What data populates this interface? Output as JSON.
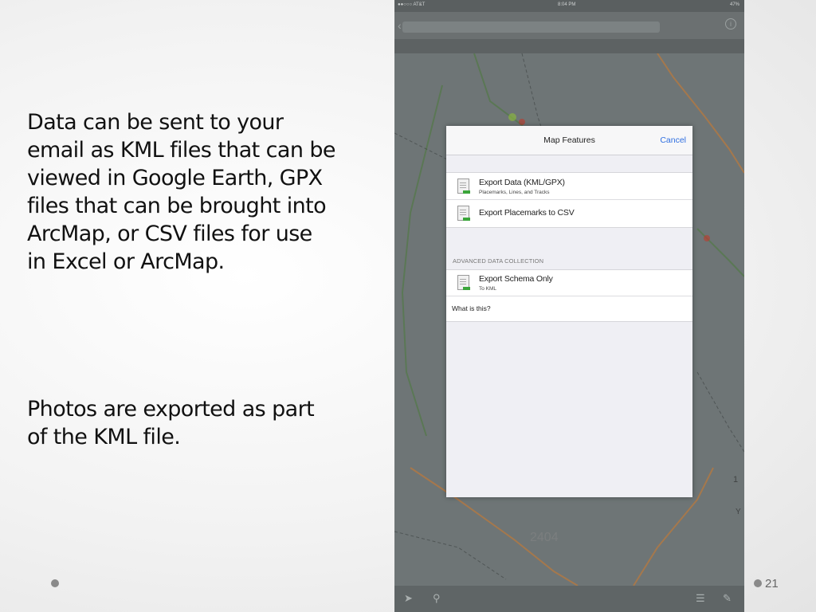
{
  "slide": {
    "paragraph1": "Data can be sent to your\nemail as KML files that can be\nviewed in Google Earth, GPX\nfiles that can be brought into\nArcMap, or CSV files for use\nin Excel or ArcMap.",
    "paragraph2": "Photos are exported as part\nof the KML file.",
    "page_number": "21"
  },
  "device": {
    "status_bar": {
      "carrier": "●●○○○ AT&T",
      "time": "8:04 PM",
      "battery": "47%"
    }
  },
  "modal": {
    "title": "Map Features",
    "cancel_label": "Cancel",
    "rows": [
      {
        "label": "Export Data (KML/GPX)",
        "sublabel": "Placemarks, Lines, and Tracks",
        "icon": "file-icon"
      },
      {
        "label": "Export Placemarks to CSV",
        "icon": "file-icon"
      }
    ],
    "section_header": "ADVANCED DATA COLLECTION",
    "advanced_rows": [
      {
        "label": "Export Schema Only",
        "sublabel": "To KML",
        "icon": "file-icon"
      },
      {
        "label": "What is this?"
      }
    ]
  },
  "map": {
    "labels": [
      "2404",
      "1",
      "Y"
    ]
  },
  "colors": {
    "modal_accent": "#2f6fe0",
    "map_route": "#d47a2a",
    "map_lines": "#4b7a3a"
  }
}
